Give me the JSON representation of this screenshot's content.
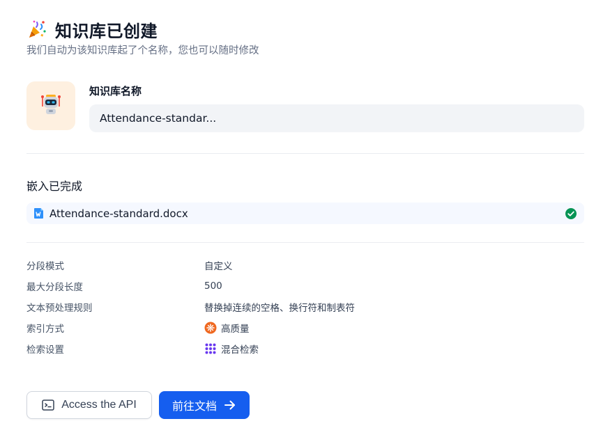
{
  "header": {
    "title": "知识库已创建",
    "subtitle": "我们自动为该知识库起了个名称，您也可以随时修改",
    "icon": "party-popper-icon"
  },
  "knowledge_base": {
    "avatar_icon": "robot-icon",
    "name_label": "知识库名称",
    "name_value": "Attendance-standar..."
  },
  "embedding": {
    "title": "嵌入已完成",
    "files": [
      {
        "name": "Attendance-standard.docx",
        "icon": "word-file-icon",
        "status_icon": "check-circle-icon"
      }
    ]
  },
  "settings": [
    {
      "key": "分段模式",
      "value": "自定义"
    },
    {
      "key": "最大分段长度",
      "value": "500"
    },
    {
      "key": "文本预处理规则",
      "value": "替换掉连续的空格、换行符和制表符"
    },
    {
      "key": "索引方式",
      "value": "高质量",
      "icon": "high-quality-icon"
    },
    {
      "key": "检索设置",
      "value": "混合检索",
      "icon": "hybrid-search-icon"
    }
  ],
  "actions": {
    "api_label": "Access the API",
    "doc_label": "前往文档"
  },
  "colors": {
    "primary": "#155eef",
    "success": "#079455",
    "avatar_bg": "#fef0e0",
    "file_row_bg": "#f5f8ff",
    "input_bg": "#f2f4f7"
  }
}
